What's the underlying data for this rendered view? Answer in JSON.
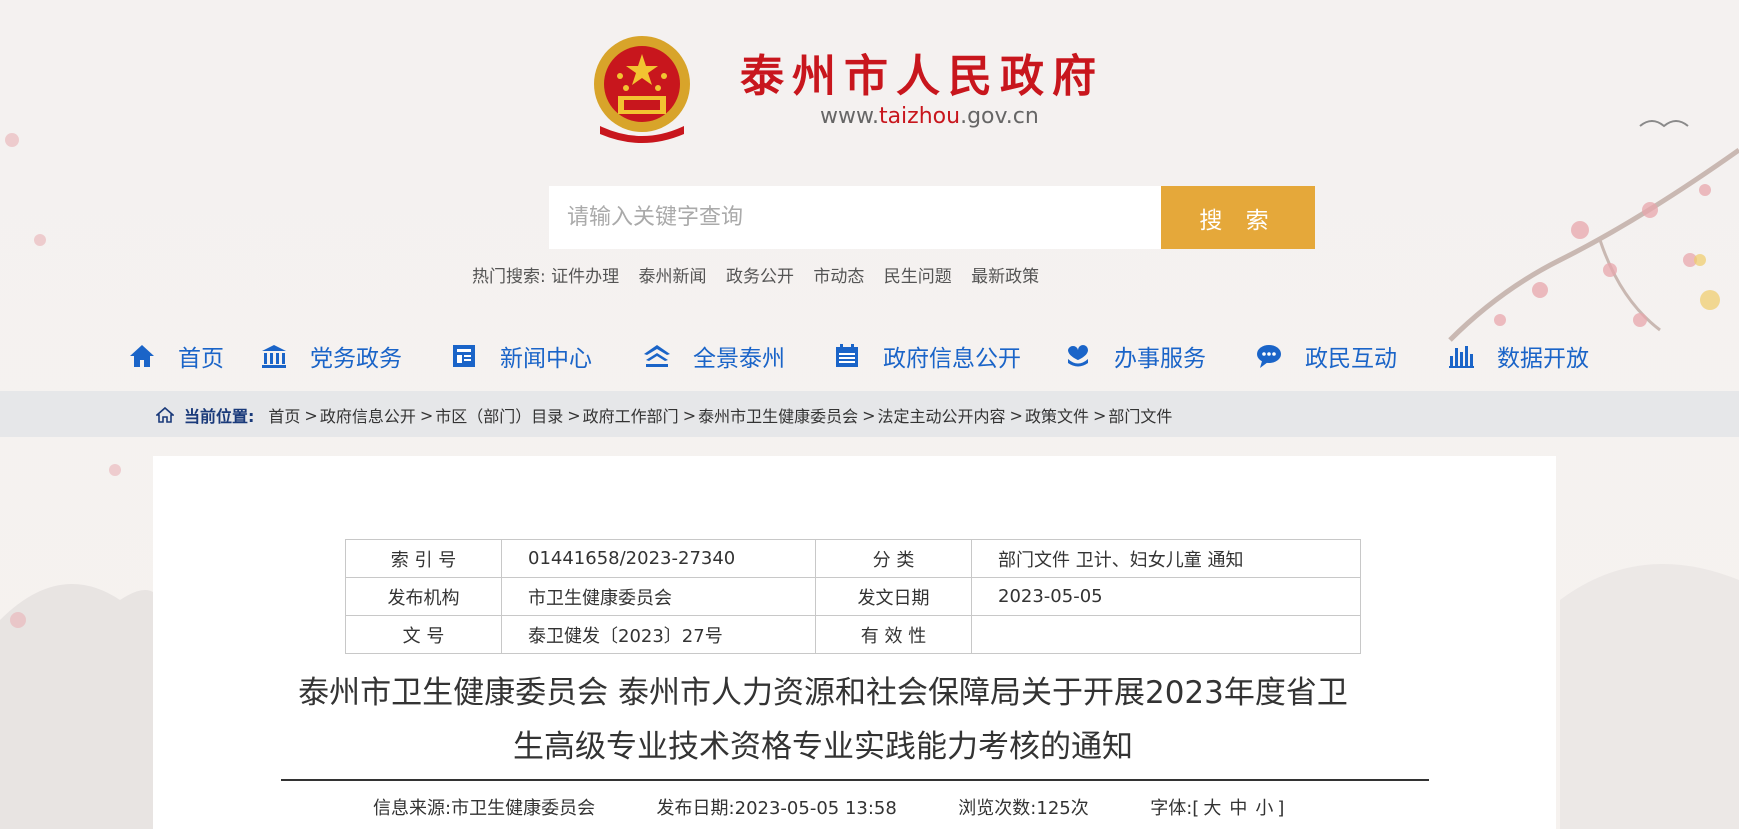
{
  "site": {
    "title": "泰州市人民政府",
    "url_prefix": "www.",
    "url_domain": "taizhou",
    "url_suffix": ".gov.cn"
  },
  "search": {
    "placeholder": "请输入关键字查询",
    "button_label": "搜 索",
    "hot_label": "热门搜索:",
    "hot_items": [
      "证件办理",
      "泰州新闻",
      "政务公开",
      "市动态",
      "民生问题",
      "最新政策"
    ]
  },
  "nav": {
    "items": [
      {
        "label": "首页",
        "icon": "home-icon"
      },
      {
        "label": "党务政务",
        "icon": "building-icon"
      },
      {
        "label": "新闻中心",
        "icon": "newspaper-icon"
      },
      {
        "label": "全景泰州",
        "icon": "landscape-icon"
      },
      {
        "label": "政府信息公开",
        "icon": "calendar-icon"
      },
      {
        "label": "办事服务",
        "icon": "service-hand-icon"
      },
      {
        "label": "政民互动",
        "icon": "chat-icon"
      },
      {
        "label": "数据开放",
        "icon": "bar-chart-icon"
      }
    ],
    "color": "#1a64c8"
  },
  "breadcrumb": {
    "lead": "当前位置:",
    "items": [
      "首页",
      "政府信息公开",
      "市区（部门）目录",
      "政府工作部门",
      "泰州市卫生健康委员会",
      "法定主动公开内容",
      "政策文件",
      "部门文件"
    ]
  },
  "meta": {
    "index_no_label": "索 引 号",
    "index_no": "01441658/2023-27340",
    "category_label": "分 类",
    "category": "部门文件 卫计、妇女儿童 通知",
    "publisher_label": "发布机构",
    "publisher": "市卫生健康委员会",
    "issue_date_label": "发文日期",
    "issue_date": "2023-05-05",
    "doc_no_label": "文 号",
    "doc_no": "泰卫健发〔2023〕27号",
    "validity_label": "有 效 性",
    "validity": ""
  },
  "document": {
    "title_line1": "泰州市卫生健康委员会 泰州市人力资源和社会保障局关于开展2023年度省卫",
    "title_line2": "生高级专业技术资格专业实践能力考核的通知",
    "source_label": "信息来源:",
    "source": "市卫生健康委员会",
    "date_label": "发布日期:",
    "date": "2023-05-05 13:58",
    "views_label": "浏览次数:",
    "views": "125次",
    "font_label": "字体:",
    "font_open": "[",
    "font_large": "大",
    "font_medium": "中",
    "font_small": "小",
    "font_close": "]"
  },
  "colors": {
    "brand_red": "#c8161d",
    "search_button": "#e5a83a",
    "nav_blue": "#1a64c8"
  }
}
